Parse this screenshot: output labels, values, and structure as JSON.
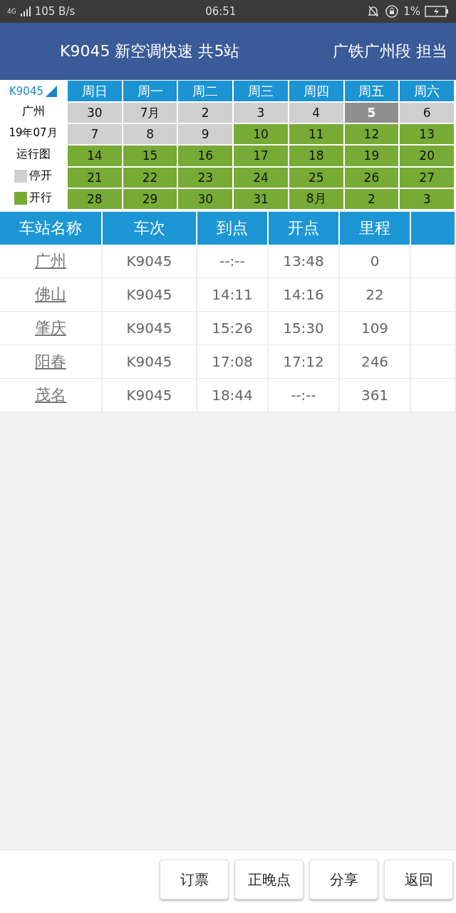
{
  "status_bar": {
    "network": "4G",
    "speed": "105 B/s",
    "time": "06:51",
    "battery": "1%"
  },
  "header": {
    "title": "K9045 新空调快速 共5站",
    "operator": "广铁广州段 担当"
  },
  "calendar": {
    "train": "K9045",
    "station": "广州",
    "month": "19年07月",
    "caption": "运行图",
    "legend": [
      {
        "label": "停开",
        "running": false
      },
      {
        "label": "开行",
        "running": true
      }
    ],
    "weekdays": [
      "周日",
      "周一",
      "周二",
      "周三",
      "周四",
      "周五",
      "周六"
    ],
    "weeks": [
      [
        {
          "day": "30",
          "running": false,
          "today": false
        },
        {
          "day": "7月",
          "running": false,
          "today": false
        },
        {
          "day": "2",
          "running": false,
          "today": false
        },
        {
          "day": "3",
          "running": false,
          "today": false
        },
        {
          "day": "4",
          "running": false,
          "today": false
        },
        {
          "day": "5",
          "running": false,
          "today": true
        },
        {
          "day": "6",
          "running": false,
          "today": false
        }
      ],
      [
        {
          "day": "7",
          "running": false,
          "today": false
        },
        {
          "day": "8",
          "running": false,
          "today": false
        },
        {
          "day": "9",
          "running": false,
          "today": false
        },
        {
          "day": "10",
          "running": true,
          "today": false
        },
        {
          "day": "11",
          "running": true,
          "today": false
        },
        {
          "day": "12",
          "running": true,
          "today": false
        },
        {
          "day": "13",
          "running": true,
          "today": false
        }
      ],
      [
        {
          "day": "14",
          "running": true,
          "today": false
        },
        {
          "day": "15",
          "running": true,
          "today": false
        },
        {
          "day": "16",
          "running": true,
          "today": false
        },
        {
          "day": "17",
          "running": true,
          "today": false
        },
        {
          "day": "18",
          "running": true,
          "today": false
        },
        {
          "day": "19",
          "running": true,
          "today": false
        },
        {
          "day": "20",
          "running": true,
          "today": false
        }
      ],
      [
        {
          "day": "21",
          "running": true,
          "today": false
        },
        {
          "day": "22",
          "running": true,
          "today": false
        },
        {
          "day": "23",
          "running": true,
          "today": false
        },
        {
          "day": "24",
          "running": true,
          "today": false
        },
        {
          "day": "25",
          "running": true,
          "today": false
        },
        {
          "day": "26",
          "running": true,
          "today": false
        },
        {
          "day": "27",
          "running": true,
          "today": false
        }
      ],
      [
        {
          "day": "28",
          "running": true,
          "today": false
        },
        {
          "day": "29",
          "running": true,
          "today": false
        },
        {
          "day": "30",
          "running": true,
          "today": false
        },
        {
          "day": "31",
          "running": true,
          "today": false
        },
        {
          "day": "8月",
          "running": true,
          "today": false
        },
        {
          "day": "2",
          "running": true,
          "today": false
        },
        {
          "day": "3",
          "running": true,
          "today": false
        }
      ]
    ]
  },
  "table": {
    "columns": [
      "车站名称",
      "车次",
      "到点",
      "开点",
      "里程"
    ],
    "rows": [
      {
        "station": "广州",
        "train": "K9045",
        "arrive": "--:--",
        "depart": "13:48",
        "distance": "0"
      },
      {
        "station": "佛山",
        "train": "K9045",
        "arrive": "14:11",
        "depart": "14:16",
        "distance": "22"
      },
      {
        "station": "肇庆",
        "train": "K9045",
        "arrive": "15:26",
        "depart": "15:30",
        "distance": "109"
      },
      {
        "station": "阳春",
        "train": "K9045",
        "arrive": "17:08",
        "depart": "17:12",
        "distance": "246"
      },
      {
        "station": "茂名",
        "train": "K9045",
        "arrive": "18:44",
        "depart": "--:--",
        "distance": "361"
      }
    ]
  },
  "buttons": [
    "订票",
    "正晚点",
    "分享",
    "返回"
  ]
}
